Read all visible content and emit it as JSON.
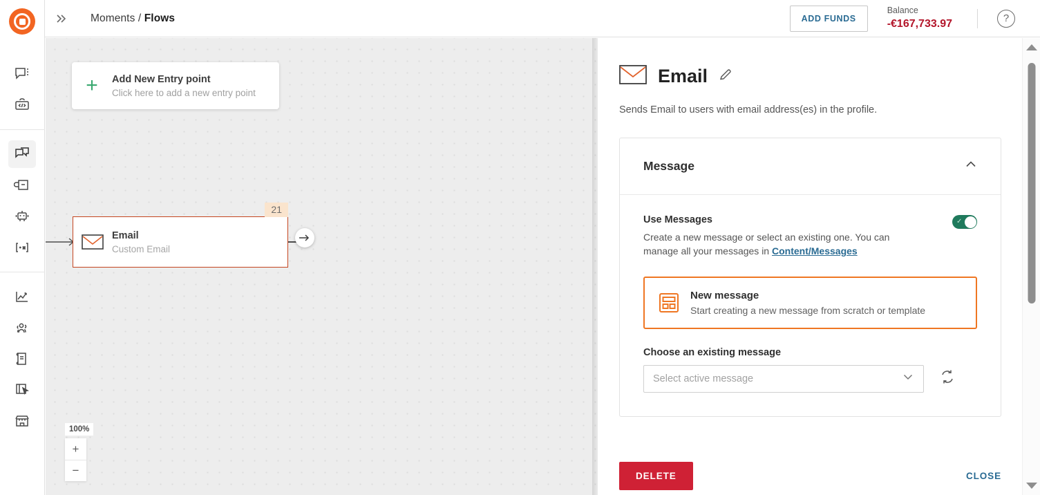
{
  "header": {
    "logo_icon": "target-logo-icon",
    "expand_icon": "chevron-double-right-icon",
    "breadcrumb_root": "Moments",
    "breadcrumb_sep": "/",
    "breadcrumb_current": "Flows",
    "add_funds_label": "ADD FUNDS",
    "balance_label": "Balance",
    "balance_value": "-€167,733.97",
    "help_icon": "question-mark-icon",
    "help_glyph": "?"
  },
  "sidebar": {
    "groups": [
      {
        "items": [
          {
            "name": "sidebar-item-conversations",
            "icon": "chat-bubble-menu-icon",
            "active": false
          },
          {
            "name": "sidebar-item-developer",
            "icon": "code-briefcase-icon",
            "active": false
          }
        ]
      },
      {
        "items": [
          {
            "name": "sidebar-item-flows",
            "icon": "flows-icon",
            "active": true
          },
          {
            "name": "sidebar-item-broadcast",
            "icon": "broadcast-folder-icon",
            "active": false
          },
          {
            "name": "sidebar-item-bots",
            "icon": "robot-icon",
            "active": false
          },
          {
            "name": "sidebar-item-variables",
            "icon": "hash-star-icon",
            "active": false
          }
        ]
      },
      {
        "items": [
          {
            "name": "sidebar-item-analytics",
            "icon": "line-chart-icon",
            "active": false
          },
          {
            "name": "sidebar-item-people",
            "icon": "people-icon",
            "active": false
          },
          {
            "name": "sidebar-item-content",
            "icon": "book-icon",
            "active": false
          },
          {
            "name": "sidebar-item-forms",
            "icon": "form-cursor-icon",
            "active": false
          },
          {
            "name": "sidebar-item-exchange",
            "icon": "storefront-icon",
            "active": false
          }
        ]
      }
    ]
  },
  "canvas": {
    "entry_node": {
      "plus_glyph": "+",
      "title": "Add New Entry point",
      "subtitle": "Click here to add a new entry point"
    },
    "email_node": {
      "icon": "envelope-icon",
      "title": "Email",
      "subtitle": "Custom Email",
      "badge": "21",
      "next_arrow_glyph": "→"
    },
    "zoom": {
      "level": "100%",
      "zoom_in_glyph": "+",
      "zoom_out_glyph": "−"
    }
  },
  "panel": {
    "icon": "envelope-icon",
    "title": "Email",
    "edit_icon": "pencil-icon",
    "description": "Sends Email to users with email address(es) in the profile.",
    "message_card": {
      "header_title": "Message",
      "collapse_icon": "chevron-up-icon",
      "use_messages": {
        "label": "Use Messages",
        "description_before": "Create a new message or select an existing one. You can manage all your messages in ",
        "link_text": "Content/Messages",
        "toggle_state": "on",
        "toggle_check_glyph": "✓"
      },
      "new_message_option": {
        "icon": "layout-template-icon",
        "title": "New message",
        "subtitle": "Start creating a new message from scratch or template",
        "selected": true
      },
      "existing_message": {
        "label": "Choose an existing message",
        "placeholder": "Select active message",
        "value": "",
        "caret_icon": "chevron-down-icon",
        "refresh_icon": "refresh-icon"
      }
    },
    "footer": {
      "delete_label": "DELETE",
      "close_label": "CLOSE"
    }
  },
  "scrollbar": {
    "up_icon": "scroll-up-arrow-icon",
    "down_icon": "scroll-down-arrow-icon",
    "thumb": "scroll-thumb"
  },
  "colors": {
    "brand_orange": "#f26522",
    "node_border": "#c4441e",
    "badge_bg": "#fae4cd",
    "link_blue": "#2a6b93",
    "balance_red": "#b3152a",
    "delete_red": "#cf2135",
    "toggle_green": "#1f7a5c",
    "entry_green": "#3aa870"
  }
}
